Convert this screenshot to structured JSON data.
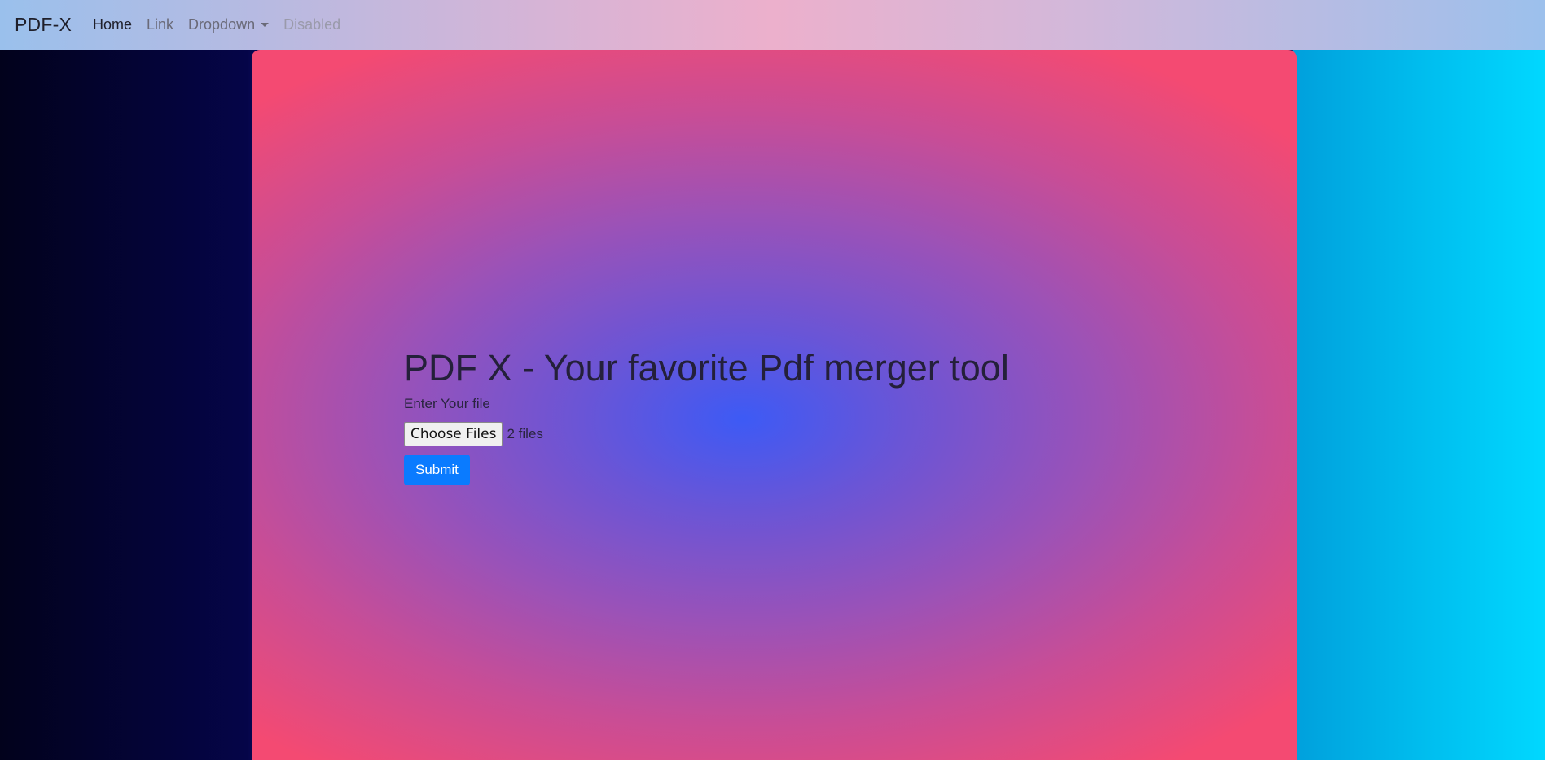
{
  "navbar": {
    "brand": "PDF-X",
    "items": [
      {
        "label": "Home"
      },
      {
        "label": "Link"
      },
      {
        "label": "Dropdown"
      },
      {
        "label": "Disabled"
      }
    ]
  },
  "main": {
    "title": "PDF X - Your favorite Pdf merger tool",
    "file_label": "Enter Your file",
    "choose_files_label": "Choose Files",
    "file_count": "2 files",
    "submit_label": "Submit"
  },
  "colors": {
    "submit_button": "#0a7bff",
    "panel_center": "#3d5af5",
    "panel_edge": "#f44a72",
    "left_background": "#07074f",
    "right_background": "#00d8ff"
  }
}
